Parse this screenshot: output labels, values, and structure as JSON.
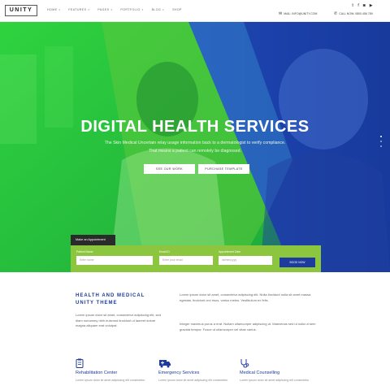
{
  "header": {
    "logo": "UNITY",
    "nav": [
      {
        "label": "HOME",
        "has_dropdown": true
      },
      {
        "label": "FEATURES",
        "has_dropdown": true
      },
      {
        "label": "PAGES",
        "has_dropdown": true
      },
      {
        "label": "PORTFOLIO",
        "has_dropdown": true
      },
      {
        "label": "BLOG",
        "has_dropdown": true
      },
      {
        "label": "SHOP",
        "has_dropdown": false
      }
    ],
    "email": "MAIL: INFO@UNITY.COM",
    "phone": "CALL NOW: 0800 456 789",
    "social": [
      "twitter-icon",
      "facebook-icon",
      "instagram-icon",
      "video-icon"
    ]
  },
  "hero": {
    "title": "DIGITAL HEALTH SERVICES",
    "subtitle_line1": "The Skin Medical Uncertain relay usage information back to a dermatologist to verify compliance.",
    "subtitle_line2": "That means a patient can remotely be diagnosed.",
    "button1": "SEE OUR WORK",
    "button2": "PURCHASE TEMPLATE",
    "colors": {
      "green": "#26c43a",
      "blue": "#1b3fb0",
      "lime": "#9fd63c"
    }
  },
  "appointment": {
    "tab_label": "Make an Appointment",
    "fields": [
      {
        "label": "Patient Name",
        "placeholder": "Enter name"
      },
      {
        "label": "Email ID",
        "placeholder": "Enter your email"
      },
      {
        "label": "Appointment Date",
        "placeholder": "dd/mm/yyyy"
      }
    ],
    "submit": "BOOK NOW",
    "color": "#8cc63e"
  },
  "content": {
    "title": "HEALTH AND MEDICAL UNITY THEME",
    "left_text": "Lorem ipsum dolor sit amet, consectetur adipiscing elit, sed diam nonummy nibh euismod tincidunt ut laoreet dolore magna aliquam erat volutpat.",
    "right_p1": "Lorem ipsum dolor sit amet, consectetur adipiscing elit. Nulla tincidunt nulla sit amet massa egestas, tincidunt orci risus, varius metus. Vestibulum ex felis.",
    "right_p2": "Integer maximus purus a erat. Nullam ullamcorper adipiscing ut. Maecenas sed ut nulla ut sem gravida tempor. Fusce ut ullamcorper vel vitae varius."
  },
  "services": [
    {
      "icon": "clipboard-icon",
      "title": "Rehabilitation Center",
      "desc": "Lorem ipsum dolor sit amet adipiscing elit consectetur"
    },
    {
      "icon": "ambulance-icon",
      "title": "Emergency Services",
      "desc": "Lorem ipsum dolor sit amet adipiscing elit consectetur"
    },
    {
      "icon": "stethoscope-icon",
      "title": "Medical Counselling",
      "desc": "Lorem ipsum dolor sit amet adipiscing elit consectetur"
    }
  ]
}
